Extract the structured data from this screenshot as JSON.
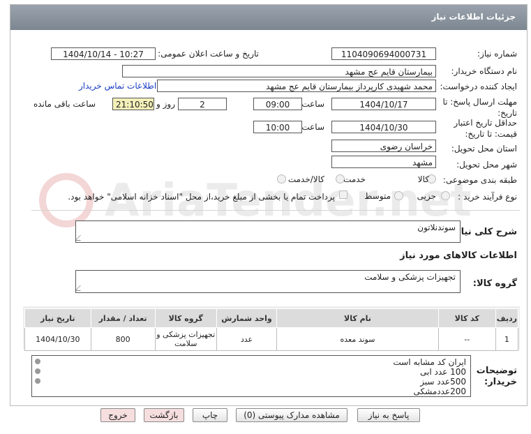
{
  "header": {
    "title": "جزئیات اطلاعات نیاز"
  },
  "fields": {
    "need_number_label": "شماره نیاز:",
    "need_number": "1104090694000731",
    "announce_label": "تاریخ و ساعت اعلان عمومی:",
    "announce_value": "1404/10/14 - 10:27",
    "buyer_org_label": "نام دستگاه خریدار:",
    "buyer_org": "بیمارستان قایم  عج  مشهد",
    "creator_label": "ایجاد کننده درخواست:",
    "creator": "محمد شهیدی کارپرداز بیمارستان قایم  عج  مشهد",
    "contact_link": "اطلاعات تماس خریدار",
    "deadline_label": "مهلت ارسال پاسخ: تا تاریخ:",
    "deadline_date": "1404/10/17",
    "time_label": "ساعت",
    "deadline_time": "09:00",
    "days_value": "2",
    "days_label": "روز و",
    "remaining_time": "21:10:50",
    "remaining_label": "ساعت باقی مانده",
    "validity_label": "حداقل تاریخ اعتبار قیمت: تا تاریخ:",
    "validity_date": "1404/10/30",
    "validity_time": "10:00",
    "province_label": "استان محل تحویل:",
    "province": "خراسان رضوی",
    "city_label": "شهر محل تحویل:",
    "city": "مشهد",
    "category_label": "طبقه بندی موضوعی:",
    "category_options": [
      "کالا",
      "خدمت",
      "کالا/خدمت"
    ],
    "process_label": "نوع فرآیند خرید :",
    "process_options": [
      "جزیی",
      "متوسط"
    ],
    "payment_note": "پرداخت تمام یا بخشی از مبلغ خرید،از محل \"اسناد خزانه اسلامی\" خواهد بود."
  },
  "description": {
    "label": "شرح کلی نیاز:",
    "value": "سوندنلاتون"
  },
  "goods_section": {
    "title": "اطلاعات کالاهای مورد نیاز"
  },
  "goods_group": {
    "label": "گروه کالا:",
    "value": "تجهیزات پزشکی و سلامت"
  },
  "table": {
    "headers": [
      "ردیف",
      "کد کالا",
      "نام کالا",
      "واحد شمارش",
      "گروه کالا",
      "تعداد / مقدار",
      "تاریخ نیاز"
    ],
    "rows": [
      [
        "1",
        "--",
        "سوند معده",
        "عدد",
        "تجهیزات پزشکی و سلامت",
        "800",
        "1404/10/30"
      ]
    ]
  },
  "buyer_notes": {
    "label": "توضیحات خریدار:",
    "lines": [
      "ایران کد مشابه است",
      "100 عدد ابی",
      "500عدد سبز",
      "200عددمشکی"
    ]
  },
  "buttons": {
    "reply": "پاسخ به نیاز",
    "docs": "مشاهده مدارک پیوستی (0)",
    "print": "چاپ",
    "back": "بازگشت",
    "exit": "خروج"
  },
  "watermark": {
    "text": "AriaTender.net"
  }
}
